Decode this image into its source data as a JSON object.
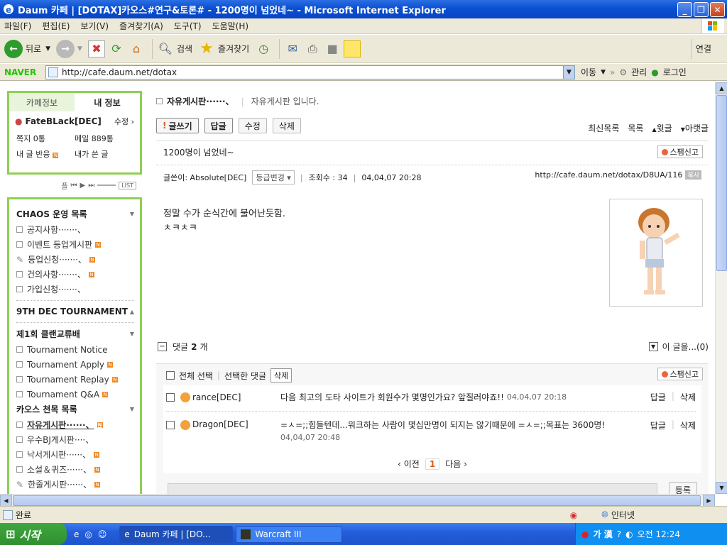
{
  "window": {
    "title": "Daum 카페 | [DOTAX]카오스#연구&토론# - 1200명이 넘었네~ - Microsoft Internet Explorer"
  },
  "menu": [
    "파일(F)",
    "편집(E)",
    "보기(V)",
    "즐겨찾기(A)",
    "도구(T)",
    "도움말(H)"
  ],
  "toolbar": {
    "back": "뒤로",
    "search": "검색",
    "favorites": "즐겨찾기",
    "connect": "연결"
  },
  "address": {
    "brand": "NAVER",
    "url": "http://cafe.daum.net/dotax",
    "go": "이동",
    "manage": "관리",
    "login": "로그인"
  },
  "sidebar": {
    "tab_cafe": "카페정보",
    "tab_my": "내 정보",
    "username": "FateBLack[DEC]",
    "edit": "수정",
    "memo": "쪽지 0통",
    "mail": "메일 889통",
    "reactions": "내 글 반응",
    "my_posts": "내가 쓴 글",
    "player_label": "플",
    "player_list": "LIST",
    "groups": [
      {
        "title": "CHAOS 운영 목록",
        "items": [
          "공지사항·······、",
          "이벤트 등업게시판",
          "등업신청·······、",
          "건의사항·······、",
          "가입신청·······、"
        ]
      },
      {
        "title": "9TH DEC TOURNAMENT",
        "items": []
      },
      {
        "title": "제1회 클랜교류배",
        "items": [
          "Tournament Notice",
          "Tournament Apply",
          "Tournament Replay",
          "Tournament Q&A"
        ]
      },
      {
        "title": "카오스 천목 목록",
        "items": [
          "자유게시판······、",
          "우수BJ게시판····、",
          "낙서게시판······、",
          "소설＆퀴즈······、",
          "한줄게시판······、"
        ]
      }
    ]
  },
  "board": {
    "name": "자유게시판······、",
    "desc": "자유게시판 입니다."
  },
  "actions": {
    "write": "글쓰기",
    "reply": "답글",
    "edit": "수정",
    "delete": "삭제",
    "recent": "최신목록",
    "list": "목록",
    "prev": "윗글",
    "next": "아랫글"
  },
  "post": {
    "title": "1200명이 넘었네~",
    "spam": "스팸신고",
    "author_label": "글쓴이: Absolute[DEC]",
    "grade": "등급변경",
    "views": "조회수 : 34",
    "date": "04,04,07 20:28",
    "permalink": "http://cafe.daum.net/dotax/D8UA/116",
    "copy": "복사",
    "body_line1": "정말 수가 순식간에 불어난듯함.",
    "body_line2": "ㅊㅋㅊㅋ"
  },
  "comments": {
    "label": "댓글",
    "count": "2",
    "unit": "개",
    "this_post": "이 글을...(0)",
    "select_all": "전체 선택",
    "selected": "선택한 댓글",
    "delete": "삭제",
    "spam": "스팸신고",
    "items": [
      {
        "user": "rance[DEC]",
        "text": "다음 최고의 도타 사이트가 회원수가 몇명인가요? 앞질러야죠!!",
        "date": "04,04,07 20:18"
      },
      {
        "user": "Dragon[DEC]",
        "text": "=ㅅ=;;힘들텐데...워크하는 사람이 몇십만명이 되지는 않기때문에 =ㅅ=;;목표는 3600명!",
        "date": "04,04,07 20:48"
      }
    ],
    "reply": "답글",
    "del": "삭제",
    "pager_prev": "이전",
    "pager_cur": "1",
    "pager_next": "다음",
    "submit": "등록"
  },
  "status": {
    "left": "완료",
    "zone": "인터넷"
  },
  "taskbar": {
    "start": "시작",
    "task1": "Daum 카페 | [DO...",
    "task2": "Warcraft III",
    "ime": "가 漢",
    "clock": "오전 12:24"
  }
}
